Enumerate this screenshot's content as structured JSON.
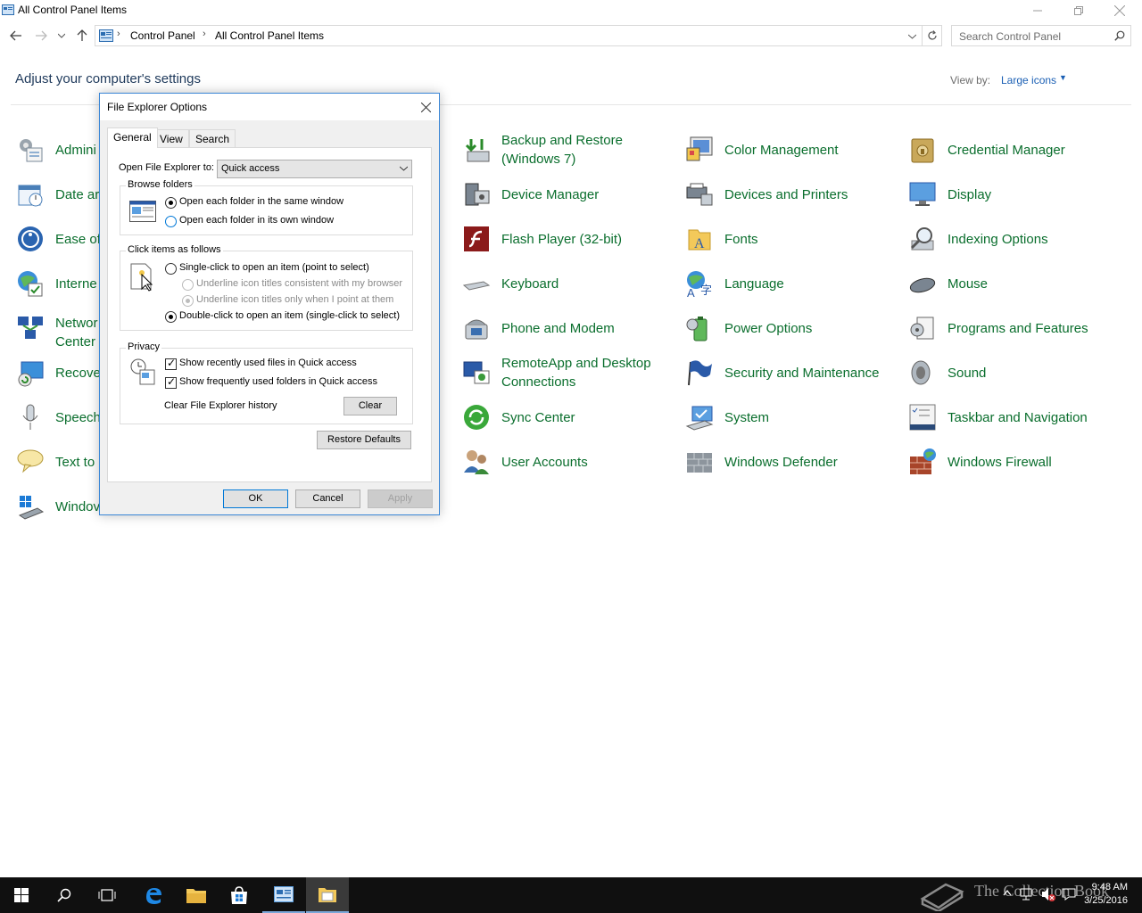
{
  "window": {
    "title": "All Control Panel Items",
    "breadcrumb": [
      "Control Panel",
      "All Control Panel Items"
    ],
    "search_placeholder": "Search Control Panel"
  },
  "header": {
    "heading": "Adjust your computer's settings",
    "view_by_label": "View by:",
    "view_by_value": "Large icons"
  },
  "items": {
    "c1": [
      "Admini",
      "Date ar",
      "Ease of",
      "Interne",
      "Networ\nCenter",
      "Recove",
      "Speech",
      "Text to",
      "Windov"
    ],
    "backup": "Backup and Restore (Windows 7)",
    "device_manager": "Device Manager",
    "flash": "Flash Player (32-bit)",
    "keyboard": "Keyboard",
    "phone": "Phone and Modem",
    "remoteapp": "RemoteApp and Desktop Connections",
    "sync": "Sync Center",
    "user_accounts": "User Accounts",
    "color": "Color Management",
    "devices_printers": "Devices and Printers",
    "fonts": "Fonts",
    "language": "Language",
    "power": "Power Options",
    "security": "Security and Maintenance",
    "system": "System",
    "defender": "Windows Defender",
    "credential": "Credential Manager",
    "display": "Display",
    "indexing": "Indexing Options",
    "mouse": "Mouse",
    "programs": "Programs and Features",
    "sound": "Sound",
    "taskbar": "Taskbar and Navigation",
    "firewall": "Windows Firewall"
  },
  "dialog": {
    "title": "File Explorer Options",
    "tabs": [
      "General",
      "View",
      "Search"
    ],
    "open_label": "Open File Explorer to:",
    "open_value": "Quick access",
    "browse_group": "Browse folders",
    "browse_same": "Open each folder in the same window",
    "browse_own": "Open each folder in its own window",
    "click_group": "Click items as follows",
    "single_click": "Single-click to open an item (point to select)",
    "underline_browser": "Underline icon titles consistent with my browser",
    "underline_point": "Underline icon titles only when I point at them",
    "double_click": "Double-click to open an item (single-click to select)",
    "privacy_group": "Privacy",
    "recent_files": "Show recently used files in Quick access",
    "frequent_folders": "Show frequently used folders in Quick access",
    "clear_history_label": "Clear File Explorer history",
    "clear_button": "Clear",
    "restore_button": "Restore Defaults",
    "ok": "OK",
    "cancel": "Cancel",
    "apply": "Apply"
  },
  "taskbar": {
    "time": "9:48 AM",
    "date": "3/25/2016",
    "watermark": "The Collection Book"
  }
}
